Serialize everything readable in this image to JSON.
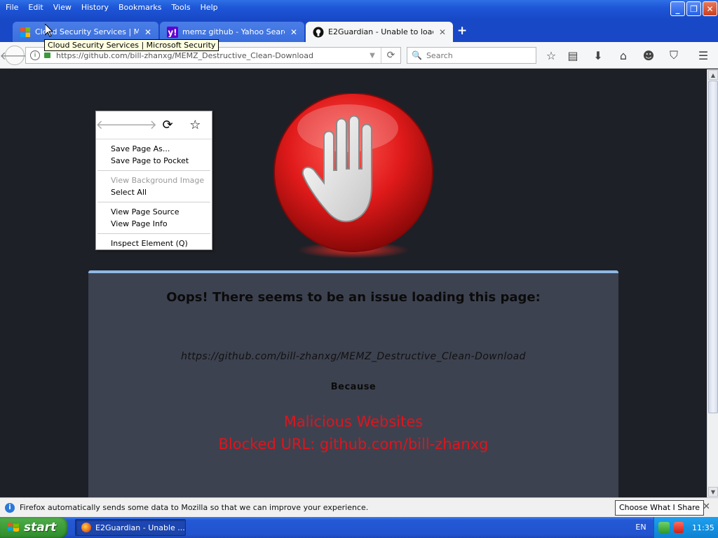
{
  "menu": [
    "File",
    "Edit",
    "View",
    "History",
    "Bookmarks",
    "Tools",
    "Help"
  ],
  "tabs": [
    {
      "title": "Cloud Security Services | Micr...",
      "state": "inactive"
    },
    {
      "title": "memz github - Yahoo Search ...",
      "state": "inactive"
    },
    {
      "title": "E2Guardian - Unable to load ...",
      "state": "active"
    }
  ],
  "tooltip": "Cloud Security Services | Microsoft Security",
  "navbar": {
    "url": "https://github.com/bill-zhanxg/MEMZ_Destructive_Clean-Download",
    "search_placeholder": "Search"
  },
  "context_menu": {
    "items": [
      {
        "label": "Save Page As...",
        "enabled": true
      },
      {
        "label": "Save Page to Pocket",
        "enabled": true
      },
      {
        "label": "View Background Image",
        "enabled": false
      },
      {
        "label": "Select All",
        "enabled": true
      },
      {
        "label": "View Page Source",
        "enabled": true
      },
      {
        "label": "View Page Info",
        "enabled": true
      },
      {
        "label": "Inspect Element (Q)",
        "enabled": true
      }
    ]
  },
  "page": {
    "title": "Oops! There seems to be an issue loading this page:",
    "url": "https://github.com/bill-zhanxg/MEMZ_Destructive_Clean-Download",
    "because": "Because",
    "reason": "Malicious Websites",
    "blocked": "Blocked URL: github.com/bill-zhanxg"
  },
  "infobar": {
    "message": "Firefox automatically sends some data to Mozilla so that we can improve your experience.",
    "button": "Choose What I Share"
  },
  "taskbar": {
    "start": "start",
    "task": "E2Guardian - Unable ...",
    "lang": "EN",
    "clock": "11:35"
  },
  "colors": {
    "page_bg": "#1e2027",
    "panel_bg": "#3d4250",
    "alert_red": "#e0141c",
    "xp_blue": "#1848c6"
  }
}
